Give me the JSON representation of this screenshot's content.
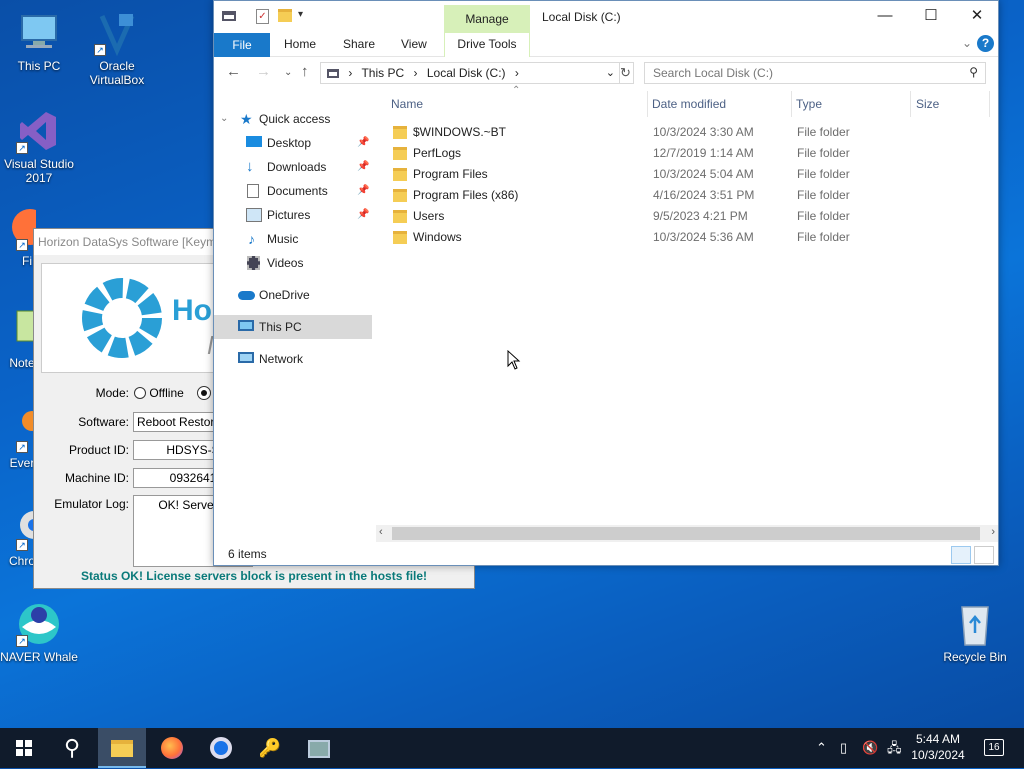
{
  "desktop": {
    "icons": {
      "this_pc": "This PC",
      "virtualbox": "Oracle\nVirtualBox",
      "visual_studio": "Visual Studio 2017",
      "firefox_partial": "Fi",
      "notepad_partial": "Note",
      "everything_partial": "Ever",
      "chrome_partial": "Chro",
      "naver_whale": "NAVER Whale",
      "recycle_bin": "Recycle Bin"
    }
  },
  "horizon": {
    "title": "Horizon DataSys Software [Keyma",
    "logo_text": "Hor",
    "logo_sub": "M",
    "mode_label": "Mode:",
    "mode_offline": "Offline",
    "software_label": "Software:",
    "software_value": "Reboot Restore",
    "product_label": "Product ID:",
    "product_value": "HDSYS-S",
    "machine_label": "Machine ID:",
    "machine_value": "0932641",
    "log_label": "Emulator Log:",
    "log_value": "OK! Server e",
    "log_value2": "Se",
    "status": "Status OK! License servers block is present in the hosts file!"
  },
  "explorer": {
    "title": "Local Disk (C:)",
    "manage_tab": "Manage",
    "ribbon": {
      "file": "File",
      "home": "Home",
      "share": "Share",
      "view": "View",
      "drive_tools": "Drive Tools"
    },
    "address": {
      "this_pc": "This PC",
      "local_disk": "Local Disk (C:)"
    },
    "search_placeholder": "Search Local Disk (C:)",
    "nav": {
      "quick_access": "Quick access",
      "desktop": "Desktop",
      "downloads": "Downloads",
      "documents": "Documents",
      "pictures": "Pictures",
      "music": "Music",
      "videos": "Videos",
      "onedrive": "OneDrive",
      "this_pc": "This PC",
      "network": "Network"
    },
    "columns": {
      "name": "Name",
      "date": "Date modified",
      "type": "Type",
      "size": "Size"
    },
    "rows": [
      {
        "name": "$WINDOWS.~BT",
        "date": "10/3/2024 3:30 AM",
        "type": "File folder"
      },
      {
        "name": "PerfLogs",
        "date": "12/7/2019 1:14 AM",
        "type": "File folder"
      },
      {
        "name": "Program Files",
        "date": "10/3/2024 5:04 AM",
        "type": "File folder"
      },
      {
        "name": "Program Files (x86)",
        "date": "4/16/2024 3:51 PM",
        "type": "File folder"
      },
      {
        "name": "Users",
        "date": "9/5/2023 4:21 PM",
        "type": "File folder"
      },
      {
        "name": "Windows",
        "date": "10/3/2024 5:36 AM",
        "type": "File folder"
      }
    ],
    "status": "6 items"
  },
  "taskbar": {
    "time": "5:44 AM",
    "date": "10/3/2024",
    "notifications": "16"
  },
  "colors": {
    "accent": "#1979ca",
    "manage_tab": "#d7f0b9",
    "status_text": "#0a7a7a",
    "taskbar": "#101b2b"
  }
}
